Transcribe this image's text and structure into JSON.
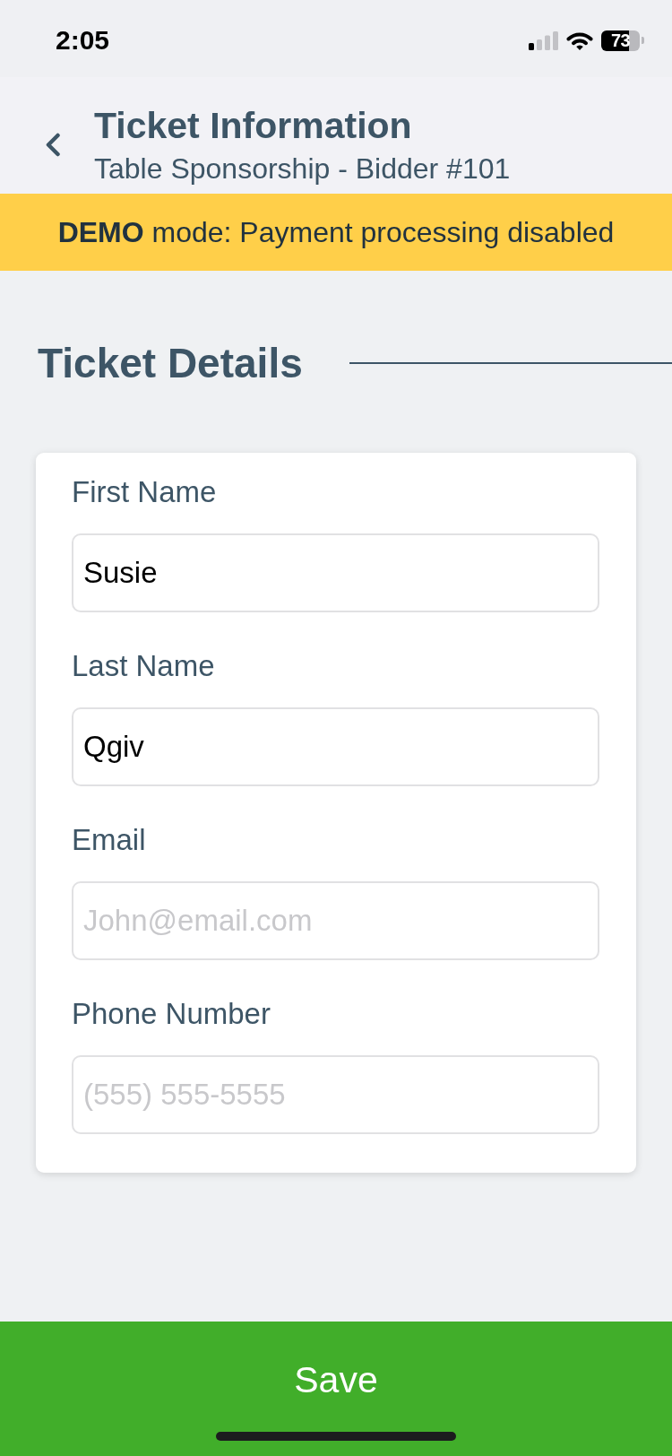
{
  "status_bar": {
    "time": "2:05",
    "battery": "73"
  },
  "header": {
    "title": "Ticket Information",
    "subtitle": "Table Sponsorship - Bidder #101"
  },
  "banner": {
    "text": "**DEMO** mode: Payment processing disabled"
  },
  "section": {
    "title": "Ticket Details"
  },
  "fields": [
    {
      "label": "First Name",
      "value": "Susie"
    },
    {
      "label": "Last Name",
      "value": "Qgiv"
    },
    {
      "label": "Email",
      "placeholder": "John@email.com"
    },
    {
      "label": "Phone Number",
      "placeholder": "(555) 555-5555"
    }
  ],
  "save_button": {
    "label": "Save"
  }
}
